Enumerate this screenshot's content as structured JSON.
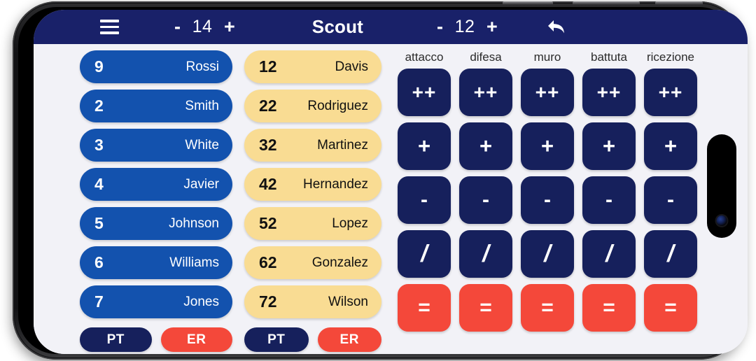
{
  "app": {
    "title": "Scout"
  },
  "appbar": {
    "menu_icon": "hamburger-menu-icon",
    "undo_icon": "undo-arrow-icon",
    "score_left": {
      "minus": "-",
      "value": "14",
      "plus": "+"
    },
    "score_right": {
      "minus": "-",
      "value": "12",
      "plus": "+"
    }
  },
  "teams": [
    {
      "style": "blue",
      "players": [
        {
          "number": "9",
          "name": "Rossi"
        },
        {
          "number": "2",
          "name": "Smith"
        },
        {
          "number": "3",
          "name": "White"
        },
        {
          "number": "4",
          "name": "Javier"
        },
        {
          "number": "5",
          "name": "Johnson"
        },
        {
          "number": "6",
          "name": "Williams"
        },
        {
          "number": "7",
          "name": "Jones"
        }
      ],
      "buttons": [
        {
          "label": "PT",
          "kind": "pt"
        },
        {
          "label": "ER",
          "kind": "er"
        }
      ]
    },
    {
      "style": "yellow",
      "players": [
        {
          "number": "12",
          "name": "Davis"
        },
        {
          "number": "22",
          "name": "Rodriguez"
        },
        {
          "number": "32",
          "name": "Martinez"
        },
        {
          "number": "42",
          "name": "Hernandez"
        },
        {
          "number": "52",
          "name": "Lopez"
        },
        {
          "number": "62",
          "name": "Gonzalez"
        },
        {
          "number": "72",
          "name": "Wilson"
        }
      ],
      "buttons": [
        {
          "label": "PT",
          "kind": "pt"
        },
        {
          "label": "ER",
          "kind": "er"
        }
      ]
    }
  ],
  "skills": {
    "columns": [
      "attacco",
      "difesa",
      "muro",
      "battuta",
      "ricezione"
    ],
    "rows": [
      {
        "label": "++",
        "kind": "navy",
        "mod": "dplus"
      },
      {
        "label": "+",
        "kind": "navy",
        "mod": "plus"
      },
      {
        "label": "-",
        "kind": "navy",
        "mod": "minus"
      },
      {
        "label": "/",
        "kind": "navy",
        "mod": "slash"
      },
      {
        "label": "=",
        "kind": "red",
        "mod": "eq"
      }
    ]
  },
  "colors": {
    "navy_bar": "#192169",
    "navy_button": "#16205c",
    "team_blue": "#1352ae",
    "team_yellow": "#f9dc93",
    "accent_red": "#f4483a",
    "screen_bg": "#f2f2f7"
  }
}
